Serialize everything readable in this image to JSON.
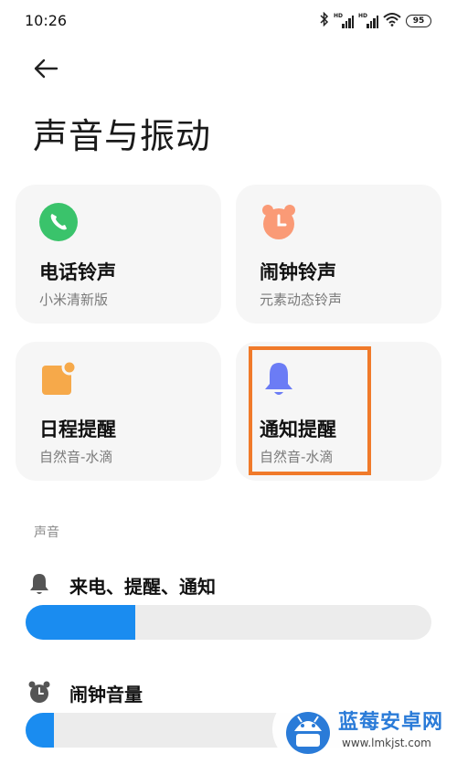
{
  "status": {
    "time": "10:26",
    "battery": "95",
    "hd1": "HD",
    "hd2": "HD",
    "icons": [
      "bluetooth-icon",
      "signal-icon",
      "signal-icon",
      "wifi-icon",
      "battery-icon"
    ]
  },
  "header": {
    "back_icon": "arrow-left-icon",
    "title": "声音与振动"
  },
  "cards": [
    {
      "title": "电话铃声",
      "subtitle": "小米清新版",
      "icon": "phone-icon",
      "color": "#3ac36b"
    },
    {
      "title": "闹钟铃声",
      "subtitle": "元素动态铃声",
      "icon": "alarm-clock-icon",
      "color": "#fa9a76"
    },
    {
      "title": "日程提醒",
      "subtitle": "自然音-水滴",
      "icon": "calendar-note-icon",
      "color": "#f6a94a"
    },
    {
      "title": "通知提醒",
      "subtitle": "自然音-水滴",
      "icon": "bell-icon",
      "color": "#6b7cf5",
      "highlighted": true
    }
  ],
  "sound_section": {
    "label": "声音",
    "sliders": [
      {
        "label": "来电、提醒、通知",
        "icon": "bell-icon",
        "value_percent": 27
      },
      {
        "label": "闹钟音量",
        "icon": "alarm-clock-icon",
        "value_percent": 7
      }
    ]
  },
  "watermark": {
    "name": "蓝莓安卓网",
    "url": "www.lmkjst.com"
  },
  "colors": {
    "accent": "#1a8cf0",
    "highlight": "#f07a2a",
    "card_bg": "#f6f6f6"
  }
}
